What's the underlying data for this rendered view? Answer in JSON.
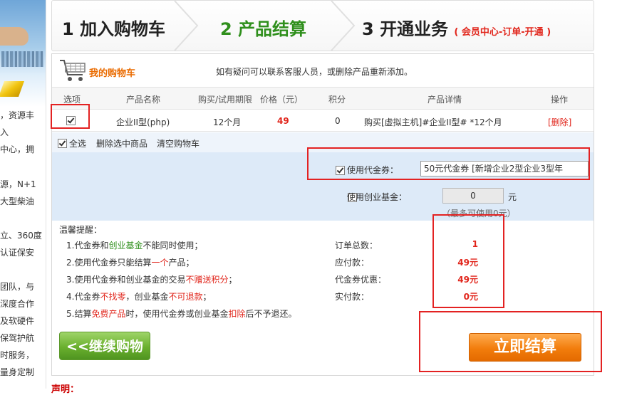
{
  "sidebar": {
    "lines": [
      "，资源丰",
      "入",
      "中心，拥",
      "源，N+1",
      "大型柴油",
      "立、360度",
      "认证保安",
      "团队，与",
      "深度合作",
      "及软硬件",
      "保驾护航",
      "时服务，",
      "量身定制"
    ]
  },
  "steps": [
    {
      "num": "1",
      "label": "加入购物车",
      "active": false
    },
    {
      "num": "2",
      "label": "产品结算",
      "active": true
    },
    {
      "num": "3",
      "label": "开通业务",
      "sub": "( 会员中心-订单-开通 )",
      "active": false
    }
  ],
  "cart": {
    "title": "我的购物车",
    "hint": "如有疑问可以联系客服人员，或删除产品重新添加。",
    "columns": [
      "选项",
      "产品名称",
      "购买/试用期限",
      "价格（元）",
      "积分",
      "产品详情",
      "操作"
    ],
    "row": {
      "name": "企业II型(php)",
      "period": "12个月",
      "price": "49",
      "points": "0",
      "detail": "购买[虚拟主机]#企业II型# *12个月",
      "action": "[删除]",
      "checked": true
    },
    "select_all": "全选",
    "delete_selected": "删除选中商品",
    "clear_cart": "清空购物车"
  },
  "voucher": {
    "label": "使用代金券：",
    "value": "50元代金券 [新增企业2型企业3型年",
    "checked": true
  },
  "fund": {
    "label": "使用创业基金：",
    "value": "0",
    "unit": "元",
    "note": "（最多可使用0元）",
    "checked": false
  },
  "tips": {
    "title": "温馨提醒：",
    "t1a": "1.代金券和",
    "t1b": "创业基金",
    "t1c": "不能同时使用；",
    "t2a": "2.使用代金券只能结算",
    "t2b": "一个",
    "t2c": "产品；",
    "t3a": "3.使用代金券和创业基金的交易",
    "t3b": "不赠送积分",
    "t3c": "；",
    "t4a": "4.代金券",
    "t4b": "不找零",
    "t4c": "，创业基金",
    "t4d": "不可退款",
    "t4e": "；",
    "t5a": "5.结算",
    "t5b": "免费产品",
    "t5c": "时，使用代金券或创业基金",
    "t5d": "扣除",
    "t5e": "后不予退还。"
  },
  "summary": {
    "total_label": "订单总数：",
    "total_value": "1",
    "payable_label": "应付款：",
    "payable_value": "49元",
    "discount_label": "代金券优惠：",
    "discount_value": "49元",
    "paid_label": "实付款：",
    "paid_value": "0元"
  },
  "buttons": {
    "continue": "<<继续购物",
    "checkout": "立即结算"
  },
  "footer": {
    "shengming": "声明："
  },
  "colors": {
    "accent_orange": "#ea6b00",
    "active_green": "#2f8f1c",
    "alert_red": "#e1261c",
    "highlight_box": "#e32222"
  }
}
